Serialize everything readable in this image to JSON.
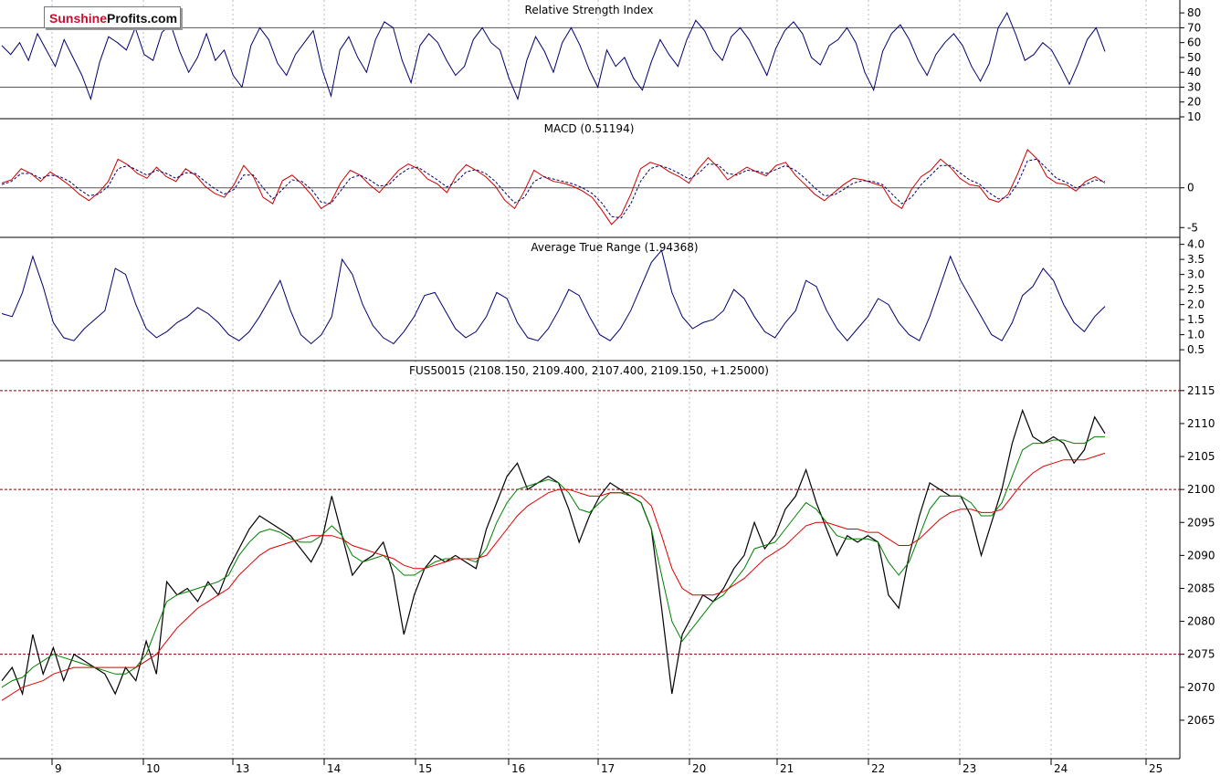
{
  "logo": {
    "part1": "Sunshine",
    "part2": "Profits.com"
  },
  "x_axis": {
    "day_labels": [
      "9",
      "10",
      "13",
      "14",
      "15",
      "16",
      "17",
      "20",
      "21",
      "22",
      "23",
      "24",
      "25"
    ]
  },
  "chart_data": [
    {
      "type": "line",
      "title": "Relative Strength Index",
      "ylim": [
        10,
        85
      ],
      "yticks": [
        10,
        20,
        30,
        40,
        50,
        60,
        70,
        80
      ],
      "reference_lines": [
        30,
        70
      ],
      "series": [
        {
          "values": [
            58,
            52,
            60,
            48,
            66,
            55,
            44,
            62,
            50,
            38,
            22,
            47,
            64,
            60,
            55,
            70,
            52,
            48,
            67,
            72,
            54,
            40,
            50,
            66,
            48,
            55,
            38,
            30,
            58,
            70,
            62,
            46,
            38,
            52,
            60,
            68,
            42,
            24,
            55,
            64,
            50,
            40,
            62,
            74,
            70,
            48,
            33,
            58,
            66,
            60,
            48,
            38,
            44,
            62,
            70,
            60,
            55,
            36,
            22,
            48,
            64,
            54,
            40,
            60,
            70,
            58,
            42,
            30,
            55,
            44,
            50,
            36,
            28,
            47,
            62,
            52,
            44,
            62,
            75,
            68,
            55,
            48,
            64,
            70,
            62,
            50,
            38,
            56,
            68,
            74,
            66,
            50,
            45,
            58,
            62,
            70,
            60,
            40,
            28,
            54,
            66,
            72,
            62,
            48,
            38,
            52,
            60,
            66,
            58,
            44,
            34,
            46,
            70,
            80,
            65,
            48,
            52,
            60,
            55,
            44,
            32,
            46,
            62,
            70,
            54
          ]
        }
      ],
      "color": "#00006e"
    },
    {
      "type": "line",
      "title": "MACD (0.51194)",
      "ylim": [
        -6,
        8
      ],
      "yticks": [
        -5,
        0
      ],
      "reference_lines": [
        0
      ],
      "series": [
        {
          "values": [
            0.6,
            1.0,
            2.4,
            1.8,
            0.8,
            2.0,
            1.2,
            0.3,
            -0.8,
            -1.6,
            -0.6,
            0.8,
            3.6,
            2.9,
            1.8,
            1.2,
            2.6,
            1.4,
            0.8,
            2.4,
            1.6,
            0.2,
            -0.7,
            -1.2,
            0.4,
            2.8,
            1.4,
            -1.2,
            -2.0,
            0.9,
            1.6,
            0.5,
            -0.9,
            -2.6,
            -1.8,
            0.6,
            2.2,
            1.6,
            0.4,
            -0.6,
            0.8,
            2.2,
            3.0,
            2.4,
            1.1,
            0.5,
            -0.6,
            1.6,
            2.9,
            2.2,
            1.4,
            0.2,
            -1.6,
            -2.6,
            -0.4,
            2.2,
            1.4,
            0.8,
            0.6,
            0.2,
            -0.4,
            -1.2,
            -2.8,
            -4.6,
            -3.4,
            -0.8,
            2.4,
            3.2,
            2.8,
            2.0,
            1.4,
            0.6,
            2.4,
            3.8,
            2.6,
            1.0,
            1.8,
            2.6,
            2.0,
            1.5,
            2.8,
            3.2,
            1.6,
            0.4,
            -0.8,
            -1.6,
            -0.6,
            0.4,
            1.2,
            1.0,
            0.6,
            0.2,
            -1.8,
            -2.6,
            -0.2,
            1.4,
            2.2,
            3.6,
            2.6,
            1.2,
            0.4,
            0.2,
            -1.4,
            -1.8,
            -0.8,
            1.8,
            4.8,
            3.6,
            1.4,
            0.6,
            0.4,
            -0.4,
            0.8,
            1.4,
            0.6
          ],
          "color": "#cc0000"
        },
        {
          "values": [
            0.4,
            0.8,
            1.8,
            1.8,
            1.2,
            1.6,
            1.4,
            0.8,
            -0.2,
            -1.0,
            -0.8,
            0.2,
            2.4,
            2.8,
            2.2,
            1.6,
            2.2,
            1.8,
            1.2,
            1.9,
            1.8,
            0.8,
            -0.1,
            -0.8,
            -0.2,
            1.6,
            1.6,
            0.0,
            -1.4,
            -0.2,
            1.0,
            0.8,
            -0.2,
            -1.8,
            -2.0,
            -0.4,
            1.2,
            1.6,
            1.0,
            0.2,
            0.4,
            1.6,
            2.4,
            2.6,
            1.8,
            1.0,
            0.1,
            0.8,
            2.0,
            2.3,
            1.8,
            0.8,
            -0.6,
            -1.9,
            -1.2,
            0.8,
            1.4,
            1.1,
            0.8,
            0.5,
            0.0,
            -0.7,
            -1.9,
            -3.6,
            -3.8,
            -2.0,
            0.8,
            2.4,
            2.8,
            2.4,
            1.8,
            1.1,
            1.8,
            3.0,
            2.9,
            1.8,
            1.6,
            2.2,
            2.1,
            1.8,
            2.3,
            2.8,
            2.2,
            1.2,
            0.0,
            -1.0,
            -0.9,
            -0.2,
            0.6,
            0.9,
            0.8,
            0.4,
            -0.8,
            -2.0,
            -1.2,
            0.4,
            1.6,
            2.8,
            2.8,
            1.9,
            1.0,
            0.5,
            -0.6,
            -1.4,
            -1.2,
            0.6,
            3.4,
            3.6,
            2.4,
            1.2,
            0.7,
            0.0,
            0.4,
            1.0,
            0.8
          ],
          "color": "#00006e",
          "dashed": true
        }
      ]
    },
    {
      "type": "line",
      "title": "Average True Range (1.94368)",
      "ylim": [
        0.2,
        4.05
      ],
      "yticks": [
        0.5,
        1.0,
        1.5,
        2.0,
        2.5,
        3.0,
        3.5,
        4.0
      ],
      "series": [
        {
          "values": [
            1.7,
            1.6,
            2.4,
            3.6,
            2.6,
            1.4,
            0.9,
            0.8,
            1.2,
            1.5,
            1.8,
            3.2,
            3.0,
            2.0,
            1.2,
            0.9,
            1.1,
            1.4,
            1.6,
            1.9,
            1.7,
            1.4,
            1.0,
            0.8,
            1.1,
            1.6,
            2.2,
            2.8,
            1.8,
            1.0,
            0.7,
            1.0,
            1.6,
            3.5,
            3.0,
            2.0,
            1.3,
            0.9,
            0.7,
            1.1,
            1.6,
            2.3,
            2.4,
            1.8,
            1.2,
            0.9,
            1.1,
            1.6,
            2.4,
            2.2,
            1.4,
            0.9,
            0.8,
            1.2,
            1.8,
            2.5,
            2.3,
            1.6,
            1.0,
            0.8,
            1.2,
            1.8,
            2.6,
            3.4,
            3.8,
            2.4,
            1.6,
            1.2,
            1.4,
            1.5,
            1.8,
            2.5,
            2.2,
            1.6,
            1.1,
            0.9,
            1.4,
            1.8,
            2.8,
            2.6,
            1.8,
            1.2,
            0.8,
            1.2,
            1.6,
            2.2,
            2.0,
            1.4,
            1.0,
            0.8,
            1.6,
            2.6,
            3.6,
            2.8,
            2.2,
            1.6,
            1.0,
            0.8,
            1.4,
            2.3,
            2.6,
            3.2,
            2.8,
            2.0,
            1.4,
            1.1,
            1.6,
            1.94
          ]
        }
      ],
      "color": "#00006e"
    },
    {
      "type": "line",
      "title": "FUS50015 (2108.150, 2109.400, 2107.400, 2109.150, +1.25000)",
      "ylim": [
        2060,
        2116.5
      ],
      "yticks": [
        2065,
        2070,
        2075,
        2080,
        2085,
        2090,
        2095,
        2100,
        2105,
        2110,
        2115
      ],
      "reference_lines": [
        2075,
        2100,
        2115
      ],
      "series": [
        {
          "name": "price",
          "color": "#000000",
          "values": [
            2071,
            2073,
            2069,
            2078,
            2072,
            2076,
            2071,
            2075,
            2074,
            2073,
            2072,
            2069,
            2073,
            2071,
            2077,
            2072,
            2086,
            2084,
            2085,
            2083,
            2086,
            2084,
            2088,
            2091,
            2094,
            2096,
            2095,
            2094,
            2093,
            2091,
            2089,
            2092,
            2099,
            2093,
            2087,
            2089,
            2090,
            2092,
            2087,
            2078,
            2084,
            2088,
            2090,
            2089,
            2090,
            2089,
            2088,
            2094,
            2098,
            2102,
            2104,
            2100,
            2101,
            2102,
            2101,
            2097,
            2092,
            2096,
            2099,
            2101,
            2100,
            2099,
            2098,
            2094,
            2082,
            2069,
            2078,
            2081,
            2084,
            2083,
            2085,
            2088,
            2090,
            2095,
            2091,
            2093,
            2097,
            2099,
            2103,
            2098,
            2094,
            2090,
            2093,
            2092,
            2093,
            2092,
            2084,
            2082,
            2090,
            2096,
            2101,
            2100,
            2099,
            2099,
            2096,
            2090,
            2095,
            2100,
            2107,
            2112,
            2108,
            2107,
            2108,
            2107,
            2104,
            2106,
            2111,
            2108.5
          ]
        },
        {
          "name": "ma_fast",
          "color": "#008000",
          "values": [
            2070,
            2071,
            2071.5,
            2073,
            2074,
            2075,
            2074.5,
            2074,
            2073.5,
            2073,
            2072.5,
            2072,
            2072,
            2073,
            2075,
            2079,
            2083,
            2084,
            2084.5,
            2085,
            2085.5,
            2086,
            2087,
            2090,
            2092,
            2093.5,
            2094,
            2093.5,
            2092.5,
            2092,
            2092,
            2093,
            2094.5,
            2093,
            2090,
            2089,
            2089.5,
            2090,
            2088.5,
            2087,
            2087,
            2088,
            2089,
            2089.5,
            2089.5,
            2089.5,
            2089,
            2091,
            2095,
            2098,
            2100,
            2100.5,
            2101,
            2101.5,
            2101,
            2099.5,
            2097,
            2096.5,
            2098,
            2099.5,
            2099.5,
            2099,
            2098,
            2094,
            2087,
            2080,
            2077,
            2079,
            2081,
            2083,
            2084,
            2086,
            2088,
            2091,
            2091.5,
            2092,
            2094,
            2096,
            2098,
            2097,
            2095,
            2093,
            2092.5,
            2092.5,
            2092.5,
            2092,
            2089,
            2087,
            2089,
            2093,
            2097,
            2099,
            2099,
            2099,
            2098,
            2096,
            2096,
            2098,
            2102,
            2106,
            2107,
            2107,
            2107.5,
            2107.5,
            2107,
            2107,
            2108,
            2108
          ]
        },
        {
          "name": "ma_slow",
          "color": "#dd0000",
          "values": [
            2068,
            2069,
            2070,
            2070.5,
            2071,
            2072,
            2072.5,
            2073,
            2073,
            2073,
            2073,
            2073,
            2073,
            2073,
            2074,
            2075,
            2077,
            2079,
            2080.5,
            2082,
            2083,
            2084,
            2085,
            2087,
            2088.5,
            2090,
            2091,
            2091.5,
            2092,
            2092.5,
            2093,
            2093,
            2093,
            2092.5,
            2091.5,
            2091,
            2090.5,
            2090,
            2089.5,
            2088.5,
            2088,
            2088,
            2088.5,
            2089,
            2089.5,
            2089.5,
            2089.5,
            2090,
            2092,
            2094,
            2096,
            2097.5,
            2098.5,
            2099.5,
            2100,
            2100,
            2099.5,
            2099,
            2099,
            2099.5,
            2099.5,
            2099.5,
            2099,
            2097.5,
            2093,
            2088,
            2085,
            2084,
            2084,
            2084,
            2084.5,
            2085.5,
            2086.5,
            2088,
            2089.5,
            2090.5,
            2091.5,
            2093,
            2094.5,
            2095,
            2095,
            2094.5,
            2094,
            2094,
            2093.5,
            2093.5,
            2092.5,
            2091.5,
            2091.5,
            2092.5,
            2094,
            2095.5,
            2096.5,
            2097,
            2097,
            2096.5,
            2096.5,
            2097,
            2099,
            2101,
            2102.5,
            2103.5,
            2104,
            2104.5,
            2104.5,
            2104.5,
            2105,
            2105.5
          ]
        }
      ]
    }
  ]
}
